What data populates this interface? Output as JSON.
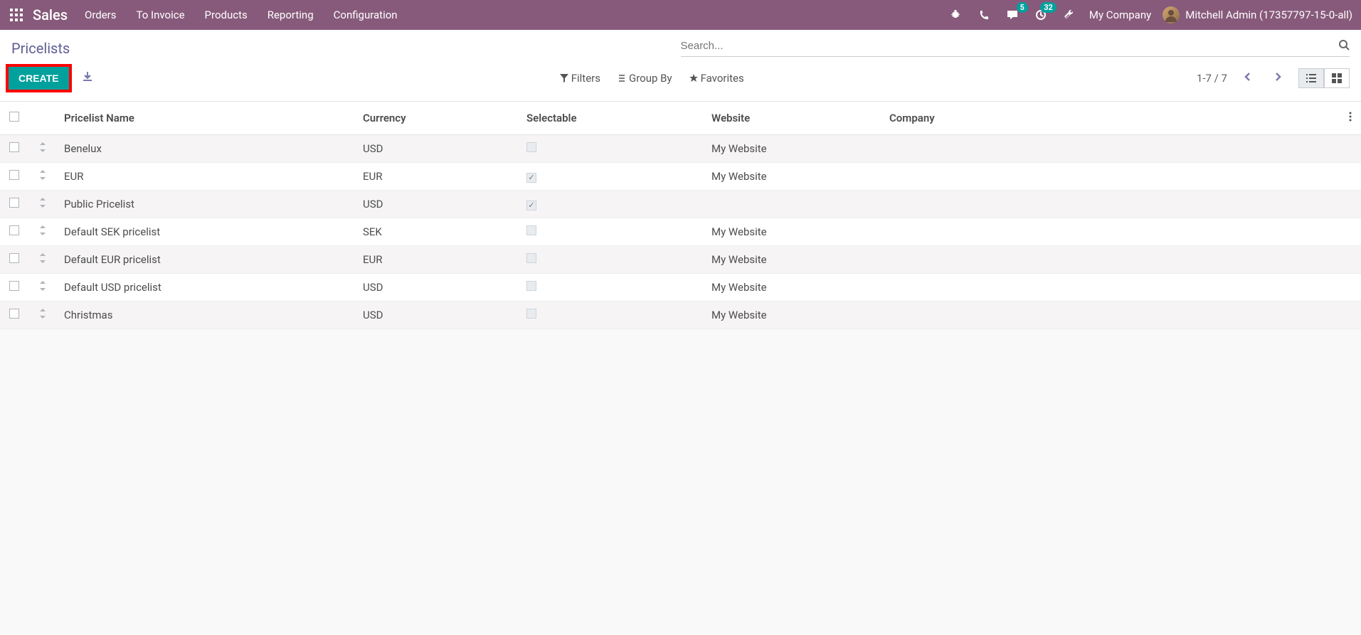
{
  "nav": {
    "brand": "Sales",
    "menu": [
      "Orders",
      "To Invoice",
      "Products",
      "Reporting",
      "Configuration"
    ],
    "messages_badge": "5",
    "activities_badge": "32",
    "company": "My Company",
    "user": "Mitchell Admin (17357797-15-0-all)"
  },
  "control": {
    "title": "Pricelists",
    "create_label": "CREATE",
    "search_placeholder": "Search...",
    "filters_label": "Filters",
    "groupby_label": "Group By",
    "favorites_label": "Favorites",
    "pager": "1-7 / 7"
  },
  "columns": {
    "name": "Pricelist Name",
    "currency": "Currency",
    "selectable": "Selectable",
    "website": "Website",
    "company": "Company"
  },
  "rows": [
    {
      "name": "Benelux",
      "currency": "USD",
      "selectable": false,
      "website": "My Website",
      "company": ""
    },
    {
      "name": "EUR",
      "currency": "EUR",
      "selectable": true,
      "website": "My Website",
      "company": ""
    },
    {
      "name": "Public Pricelist",
      "currency": "USD",
      "selectable": true,
      "website": "",
      "company": ""
    },
    {
      "name": "Default SEK pricelist",
      "currency": "SEK",
      "selectable": false,
      "website": "My Website",
      "company": ""
    },
    {
      "name": "Default EUR pricelist",
      "currency": "EUR",
      "selectable": false,
      "website": "My Website",
      "company": ""
    },
    {
      "name": "Default USD pricelist",
      "currency": "USD",
      "selectable": false,
      "website": "My Website",
      "company": ""
    },
    {
      "name": "Christmas",
      "currency": "USD",
      "selectable": false,
      "website": "My Website",
      "company": ""
    }
  ]
}
